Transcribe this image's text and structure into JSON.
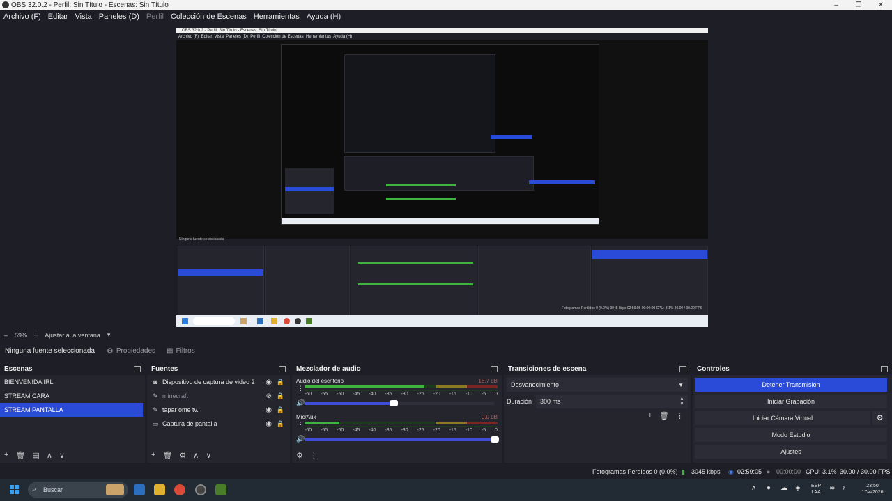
{
  "window": {
    "title": "OBS 32.0.2 - Perfil: Sin Título - Escenas: Sin Título",
    "controls": [
      "–",
      "❐",
      "✕"
    ]
  },
  "menu": [
    {
      "label": "Archivo (F)",
      "dim": false
    },
    {
      "label": "Editar",
      "dim": false
    },
    {
      "label": "Vista",
      "dim": false
    },
    {
      "label": "Paneles (D)",
      "dim": false
    },
    {
      "label": "Perfil",
      "dim": true
    },
    {
      "label": "Colección de Escenas",
      "dim": false
    },
    {
      "label": "Herramientas",
      "dim": false
    },
    {
      "label": "Ayuda (H)",
      "dim": false
    }
  ],
  "zoom": {
    "minus": "–",
    "value": "59%",
    "plus": "+",
    "fit": "Ajustar a la ventana",
    "caret": "▾"
  },
  "context": {
    "no_source": "Ninguna fuente seleccionada",
    "properties": "Propiedades",
    "filters": "Filtros"
  },
  "scenes": {
    "title": "Escenas",
    "items": [
      "BIENVENIDA IRL",
      "STREAM CARA",
      "STREAM PANTALLA"
    ],
    "active_index": 2
  },
  "sources": {
    "title": "Fuentes",
    "items": [
      {
        "label": "Dispositivo de captura de video 2",
        "icon": "camera-icon",
        "visible": true
      },
      {
        "label": "minecraft",
        "icon": "game-icon",
        "visible": false
      },
      {
        "label": "tapar ome tv.",
        "icon": "brush-icon",
        "visible": true
      },
      {
        "label": "Captura de pantalla",
        "icon": "monitor-icon",
        "visible": true
      }
    ]
  },
  "mixer": {
    "title": "Mezclador de audio",
    "channels": [
      {
        "name": "Audio del escritorio",
        "db": "-18.7 dB",
        "level": 0.62,
        "volume": 0.47
      },
      {
        "name": "Mic/Aux",
        "db": "0.0 dB",
        "level": 0.18,
        "volume": 1.0
      }
    ],
    "ticks": [
      "-60",
      "-55",
      "-50",
      "-45",
      "-40",
      "-35",
      "-30",
      "-25",
      "-20",
      "-15",
      "-10",
      "-5",
      "0"
    ]
  },
  "transitions": {
    "title": "Transiciones de escena",
    "selected": "Desvanecimiento",
    "duration_label": "Duración",
    "duration_value": "300 ms"
  },
  "controls": {
    "title": "Controles",
    "buttons": [
      "Detener Transmisión",
      "Iniciar Grabación",
      "Iniciar Cámara Virtual",
      "Modo Estudio",
      "Ajustes"
    ]
  },
  "status": {
    "dropped": "Fotogramas Perdidos 0 (0.0%)",
    "bitrate": "3045 kbps",
    "stream_time": "02:59:05",
    "rec_time": "00:00:00",
    "cpu": "CPU: 3.1%",
    "fps": "30.00 / 30.00 FPS"
  },
  "taskbar": {
    "search": "Buscar",
    "lang1": "ESP",
    "lang2": "LAA",
    "time": "23:50",
    "date": "17/4/2026"
  },
  "preview": {
    "inner_nosel": "Ninguna fuente seleccionada",
    "inner_status": "Fotogramas Perdidos 0 (0.0%)  3045 kbps  02:59:05  00:00:00  CPU: 3.1%  30.00 / 30.00 FPS"
  },
  "colors": {
    "accent": "#2a4bd8",
    "bg": "#1e1f26",
    "panel": "#24252d"
  }
}
